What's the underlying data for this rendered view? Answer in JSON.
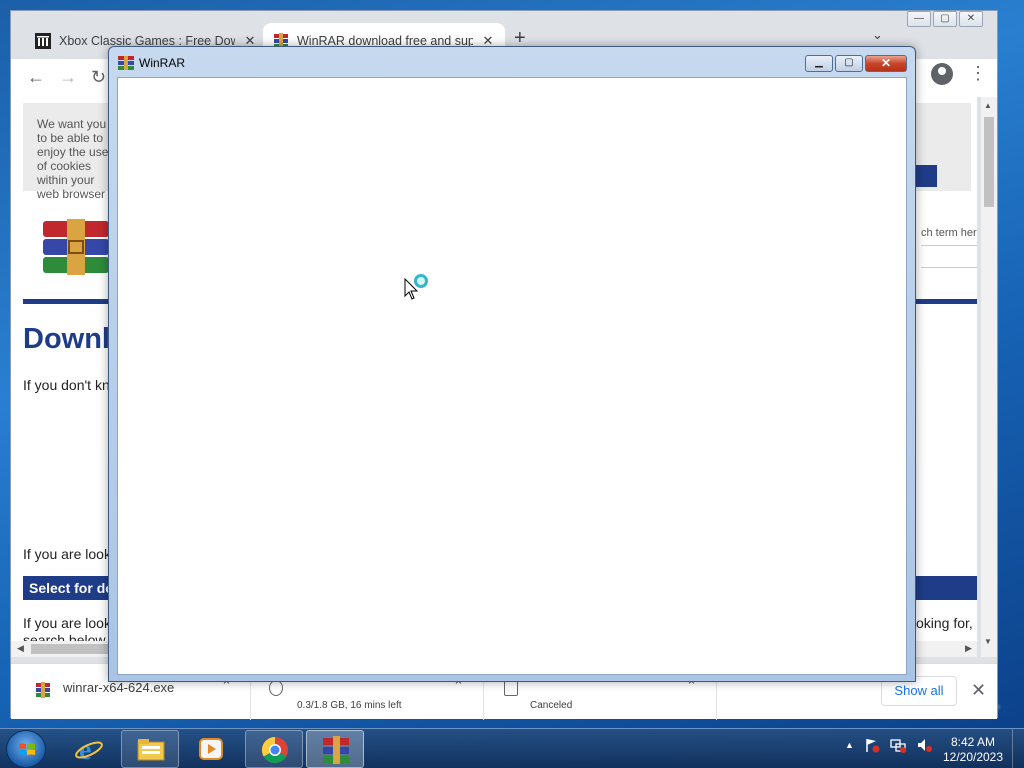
{
  "browser": {
    "tabs": [
      {
        "title": "Xbox Classic Games : Free Downl",
        "close": "✕",
        "active": false
      },
      {
        "title": "WinRAR download free and supp",
        "close": "✕",
        "active": true
      }
    ],
    "new_tab": "+",
    "tab_search": "⌄",
    "window_buttons": {
      "minimize": "—",
      "maximize": "▢",
      "close": "✕"
    },
    "nav": {
      "back": "←",
      "forward": "→",
      "reload": "↻"
    },
    "menu": "⋮"
  },
  "page": {
    "cookie_text": "We want you to be able to enjoy the use of cookies within your web browser",
    "search_hint": "ch term here",
    "heading": "Downl",
    "para1": "If you don't kn",
    "para2": "If you are look",
    "select_bar": "Select for do",
    "para3_line1": "If you are look",
    "para3_line2": "search below.",
    "para3_right": "oking for,"
  },
  "downloads": {
    "items": [
      {
        "filename": "winrar-x64-624.exe",
        "status": ""
      },
      {
        "filename": "",
        "status": "0.3/1.8 GB, 16 mins left"
      },
      {
        "filename": "",
        "status": "Canceled"
      }
    ],
    "chevron": "⌃",
    "show_all": "Show all",
    "close": "✕"
  },
  "winrar": {
    "title": "WinRAR",
    "buttons": {
      "minimize": "▁",
      "maximize": "▢",
      "close": "✕"
    }
  },
  "taskbar": {
    "clock_time": "8:42 AM",
    "clock_date": "12/20/2023",
    "tray_arrow": "▲",
    "pinned": [
      "internet-explorer",
      "file-explorer",
      "media-player",
      "chrome",
      "winrar"
    ]
  }
}
